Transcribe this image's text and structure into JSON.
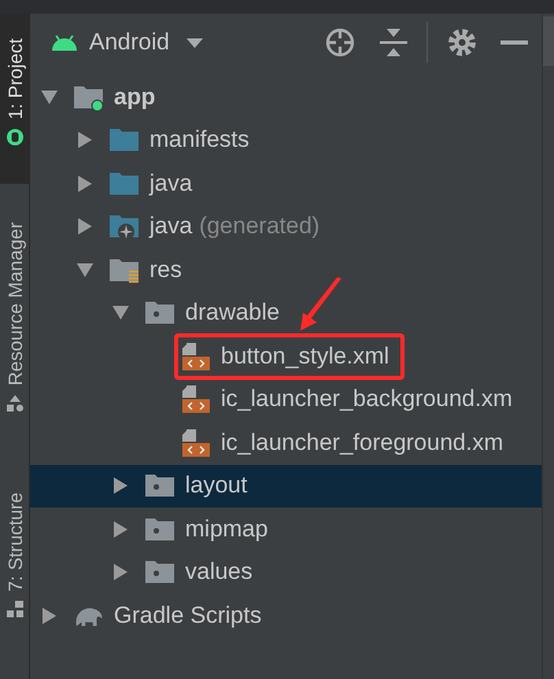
{
  "tool_strip": [
    {
      "label": "1: Project",
      "kind": "project",
      "selected": true
    },
    {
      "label": "Resource Manager",
      "kind": "resources",
      "selected": false
    },
    {
      "label": "7: Structure",
      "kind": "structure",
      "selected": false
    }
  ],
  "header": {
    "view": "Android"
  },
  "tree": [
    {
      "label": "app",
      "kind": "module",
      "expanded": true,
      "selected": false,
      "children": [
        {
          "label": "manifests",
          "kind": "folder",
          "expanded": false,
          "selected": false
        },
        {
          "label": "java",
          "kind": "folder",
          "expanded": false,
          "selected": false
        },
        {
          "label": "java",
          "note": "(generated)",
          "kind": "generated-folder",
          "expanded": false,
          "selected": false
        },
        {
          "label": "res",
          "kind": "res-folder",
          "expanded": true,
          "selected": false,
          "children": [
            {
              "label": "drawable",
              "kind": "res-subfolder",
              "expanded": true,
              "selected": false,
              "children": [
                {
                  "label": "button_style.xml",
                  "kind": "xml-file",
                  "selected": false,
                  "highlighted": true
                },
                {
                  "label": "ic_launcher_background.xm",
                  "kind": "xml-file",
                  "selected": false,
                  "highlighted": false
                },
                {
                  "label": "ic_launcher_foreground.xm",
                  "kind": "xml-file",
                  "selected": false,
                  "highlighted": false
                }
              ]
            },
            {
              "label": "layout",
              "kind": "res-subfolder",
              "expanded": false,
              "selected": true
            },
            {
              "label": "mipmap",
              "kind": "res-subfolder",
              "expanded": false,
              "selected": false
            },
            {
              "label": "values",
              "kind": "res-subfolder",
              "expanded": false,
              "selected": false
            }
          ]
        }
      ]
    },
    {
      "label": "Gradle Scripts",
      "kind": "gradle",
      "expanded": false,
      "selected": false
    }
  ]
}
